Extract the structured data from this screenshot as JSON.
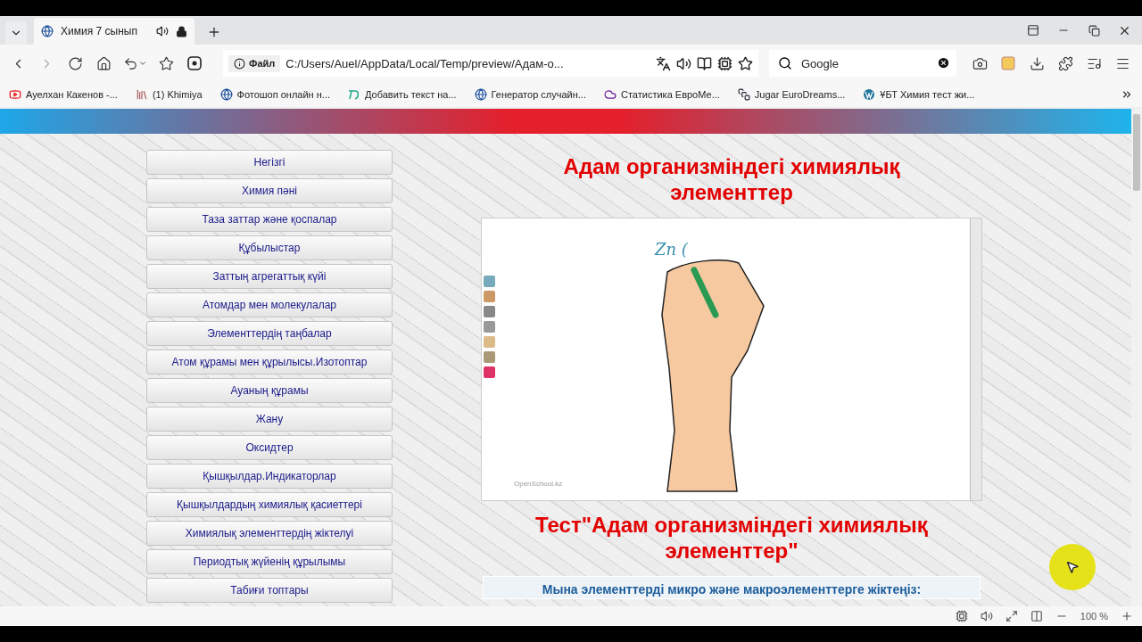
{
  "browser": {
    "tabs": [
      {
        "title": "Химия 7 сынып",
        "selected": true
      }
    ],
    "address": {
      "scheme_label": "Файл",
      "url": "C:/Users/Auel/AppData/Local/Temp/preview/Адам-о..."
    },
    "search": {
      "placeholder": "Google"
    },
    "bookmarks": [
      {
        "label": "Ауелхан Какенов -...",
        "kind": "video"
      },
      {
        "label": "(1) Khimiya",
        "kind": "books"
      },
      {
        "label": "Фотошоп онлайн н...",
        "kind": "globe"
      },
      {
        "label": "Добавить текст на...",
        "kind": "td"
      },
      {
        "label": "Генератор случайн...",
        "kind": "globe"
      },
      {
        "label": "Статистика ЕвроМе...",
        "kind": "cloud"
      },
      {
        "label": "Jugar EuroDreams...",
        "kind": "square"
      },
      {
        "label": "ҰБТ Химия тест жи...",
        "kind": "wp"
      }
    ],
    "zoom": "100 %"
  },
  "page": {
    "nav": [
      "Негізгі",
      "Химия пәні",
      "Таза заттар және қоспалар",
      "Құбылыстар",
      "Заттың агрегаттық күйі",
      "Атомдар мен молекулалар",
      "Элементтердің таңбалар",
      "Атом құрамы мен құрылысы.Изотоптар",
      "Ауаның құрамы",
      "Жану",
      "Оксидтер",
      "Қышқылдар.Индикаторлар",
      "Қышқылдардың химиялық қасиеттері",
      "Химиялық элементтердің жіктелуі",
      "Периодтық жүйенің құрылымы",
      "Табиғи топтары"
    ],
    "title": "Адам организміндегі химиялық элементтер",
    "video": {
      "handwriting": "Zn (",
      "watermark": "OpenSchool.kz"
    },
    "test_title": "Тест\"Адам организміндегі химиялық элементтер\"",
    "question": "Мына элементтерді микро және макроэлементтерге жіктеңіз:"
  }
}
